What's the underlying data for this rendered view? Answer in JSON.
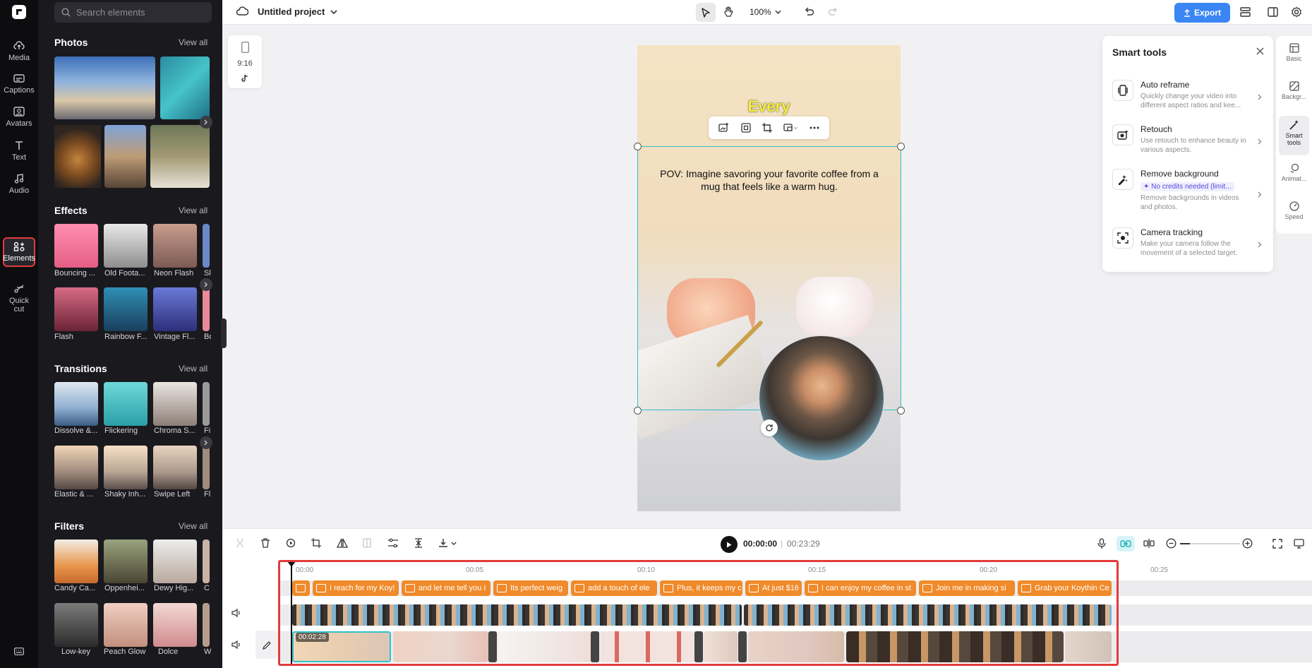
{
  "rail": [
    {
      "label": "Media",
      "icon": "cloud-upload-icon"
    },
    {
      "label": "Captions",
      "icon": "captions-icon"
    },
    {
      "label": "Avatars",
      "icon": "avatar-icon"
    },
    {
      "label": "Text",
      "icon": "text-icon"
    },
    {
      "label": "Audio",
      "icon": "music-note-icon"
    },
    {
      "label": "Elements",
      "icon": "elements-icon",
      "active": true
    },
    {
      "label": "Quick cut",
      "icon": "scissors-icon"
    }
  ],
  "panel": {
    "search_placeholder": "Search elements",
    "photos": {
      "title": "Photos",
      "viewall": "View all"
    },
    "effects": {
      "title": "Effects",
      "viewall": "View all",
      "items": [
        "Bouncing ...",
        "Old Foota...",
        "Neon Flash",
        "Sl",
        "Flash",
        "Rainbow F...",
        "Vintage Fl...",
        "Bo"
      ]
    },
    "transitions": {
      "title": "Transitions",
      "viewall": "View all",
      "items": [
        "Dissolve &...",
        "Flickering",
        "Chroma S...",
        "Fi",
        "Elastic & ...",
        "Shaky Inh...",
        "Swipe Left",
        "Fl"
      ]
    },
    "filters": {
      "title": "Filters",
      "viewall": "View all",
      "items": [
        "Candy Ca...",
        "Oppenhei...",
        "Dewy Hig...",
        "C",
        "Low-key",
        "Peach Glow",
        "Dolce",
        "W"
      ]
    }
  },
  "topbar": {
    "project_title": "Untitled project",
    "zoom": "100%",
    "export_label": "Export"
  },
  "canvas": {
    "ratio_label": "9:16",
    "caption_word": "Every",
    "pov_text": "POV: Imagine savoring your favorite coffee from a mug that feels like a warm hug."
  },
  "smart_tools": {
    "title": "Smart tools",
    "items": [
      {
        "title": "Auto reframe",
        "desc": "Quickly change your video into different aspect ratios and kee..."
      },
      {
        "title": "Retouch",
        "desc": "Use retouch to enhance beauty in various aspects."
      },
      {
        "title": "Remove background",
        "badge": "No credits needed (limit...",
        "desc": "Remove backgrounds in videos and photos."
      },
      {
        "title": "Camera tracking",
        "desc": "Make your camera follow the movement of a selected target."
      }
    ]
  },
  "right_rail": [
    {
      "label": "Basic"
    },
    {
      "label": "Backgr..."
    },
    {
      "label": "Smart tools",
      "active": true
    },
    {
      "label": "Animat..."
    },
    {
      "label": "Speed"
    }
  ],
  "timeline": {
    "current_time": "00:00:00",
    "total_time": "00:23:29",
    "ruler": [
      "00:00",
      "00:05",
      "00:10",
      "00:15",
      "00:20",
      "00:25"
    ],
    "captions": [
      "",
      "I reach for my Koy!",
      "and let me tell you I",
      "Its perfect weig",
      "add a touch of ele",
      "Plus, it keeps my c",
      "At just $16",
      "I can enjoy my coffee in st",
      "Join me in making si",
      "Grab your Koythin Ce"
    ],
    "clip_time": "00:02:28"
  },
  "colors": {
    "accent": "#3a86f5",
    "highlight": "#e23b3b",
    "caption_clip": "#f08a2a",
    "selection": "#2fc2c9"
  }
}
